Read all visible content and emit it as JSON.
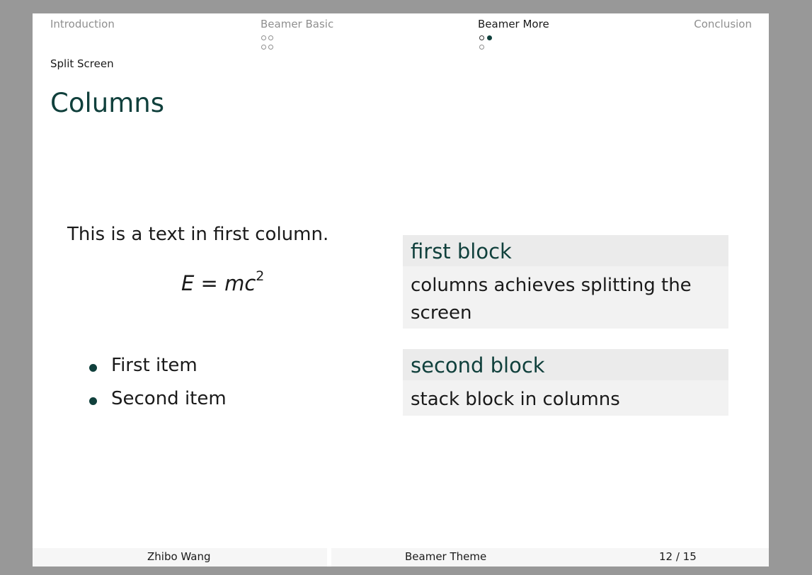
{
  "nav": {
    "sections": [
      {
        "label": "Introduction",
        "active": false
      },
      {
        "label": "Beamer Basic",
        "active": false
      },
      {
        "label": "Beamer More",
        "active": true
      },
      {
        "label": "Conclusion",
        "active": false
      }
    ]
  },
  "subsection": "Split Screen",
  "frame_title": "Columns",
  "left_column": {
    "text": "This is a text in first column.",
    "equation": {
      "lhs": "E",
      "equals": "=",
      "rhs": "mc",
      "exponent": "2"
    },
    "items": [
      "First item",
      "Second item"
    ]
  },
  "right_column": {
    "blocks": [
      {
        "title": "first block",
        "body": "columns achieves splitting the screen"
      },
      {
        "title": "second block",
        "body": "stack block in columns"
      }
    ]
  },
  "footer": {
    "author": "Zhibo Wang",
    "title": "Beamer Theme",
    "page": "12 / 15"
  },
  "colors": {
    "accent": "#10403c",
    "nav_inactive": "#8f8f8f",
    "block_title_bg": "#ebebeb",
    "block_body_bg": "#f2f2f2",
    "background": "#989898"
  }
}
